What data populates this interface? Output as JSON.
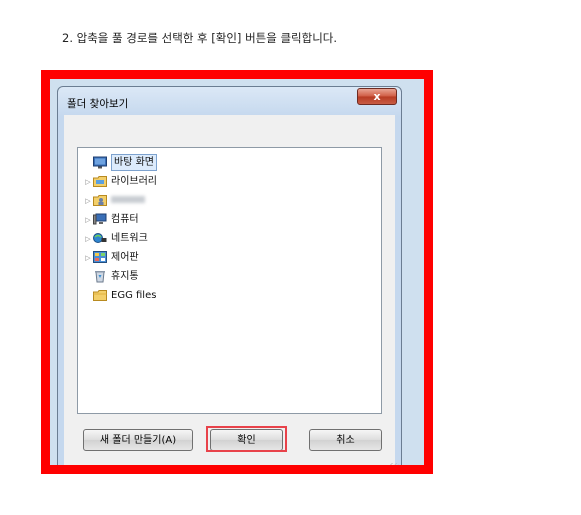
{
  "instruction": "2. 압축을 풀 경로를 선택한 후 [확인] 버튼을 클릭합니다.",
  "dialog": {
    "title": "폴더 찾아보기",
    "ghost_text_1": "",
    "ghost_text_2": "",
    "close_label": "x"
  },
  "tree": {
    "items": [
      {
        "label": "바탕 화면",
        "icon": "desktop-icon",
        "has_arrow": false,
        "selected": true
      },
      {
        "label": "라이브러리",
        "icon": "library-folder-icon",
        "has_arrow": true
      },
      {
        "label": "",
        "icon": "user-folder-icon",
        "has_arrow": true
      },
      {
        "label": "컴퓨터",
        "icon": "computer-icon",
        "has_arrow": true
      },
      {
        "label": "네트워크",
        "icon": "network-icon",
        "has_arrow": true
      },
      {
        "label": "제어판",
        "icon": "control-panel-icon",
        "has_arrow": true
      },
      {
        "label": "휴지통",
        "icon": "recycle-bin-icon",
        "has_arrow": false
      },
      {
        "label": "EGG files",
        "icon": "folder-icon",
        "has_arrow": false
      }
    ]
  },
  "buttons": {
    "new_folder": "새 폴더 만들기(A)",
    "ok": "확인",
    "cancel": "취소"
  },
  "colors": {
    "highlight_frame": "#ff0000",
    "ok_highlight": "#e8424a",
    "close_button": "#c85c44",
    "selection_border": "#7da2ce"
  }
}
